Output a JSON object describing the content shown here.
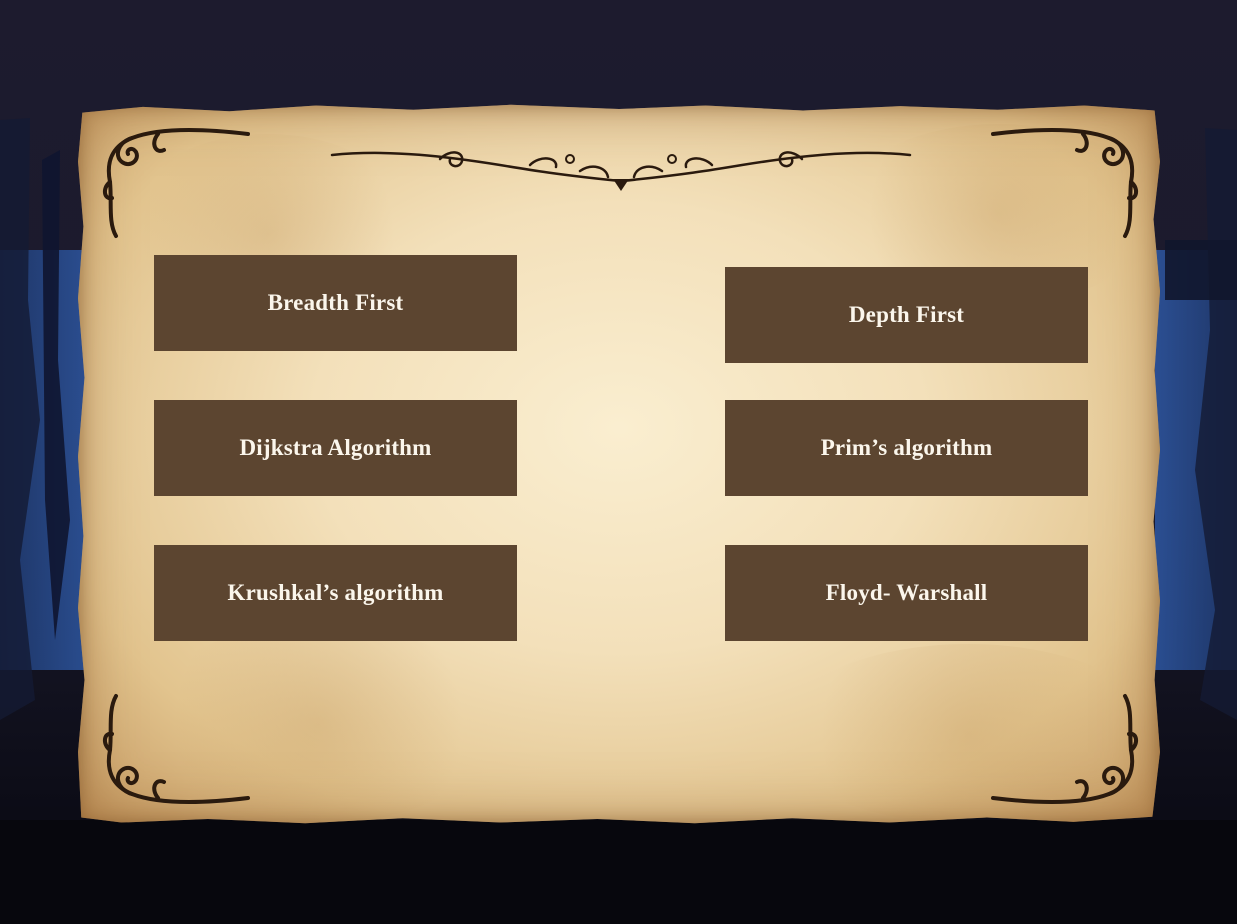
{
  "menu": {
    "buttons": [
      {
        "id": "bfs",
        "label": "Breadth First"
      },
      {
        "id": "dfs",
        "label": "Depth First"
      },
      {
        "id": "dijkstra",
        "label": "Dijkstra Algorithm"
      },
      {
        "id": "prim",
        "label": "Prim’s algorithm"
      },
      {
        "id": "kruskal",
        "label": "Krushkal’s algorithm"
      },
      {
        "id": "floyd",
        "label": "Floyd- Warshall"
      }
    ]
  },
  "colors": {
    "button_bg": "#5c4530",
    "button_text": "#fbf6ec",
    "ornament": "#2a1a0e",
    "night_sky": "#1b1a2b",
    "forest_blue": "#2b4a88"
  }
}
